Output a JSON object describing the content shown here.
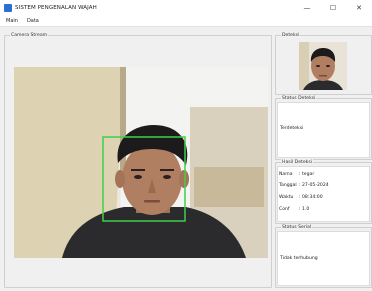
{
  "window": {
    "title": "SISTEM PENGENALAN WAJAH",
    "minimize_glyph": "—",
    "maximize_glyph": "☐",
    "close_glyph": "✕"
  },
  "menu": {
    "items": [
      "Main",
      "Data"
    ]
  },
  "camera": {
    "group_title": "Camera Stream",
    "face_box_color": "#3ecf4a"
  },
  "detect_panel": {
    "title": "Deteksi"
  },
  "status_detect": {
    "title": "Status Deteksi",
    "value": "Terdeteksi"
  },
  "result": {
    "title": "Hasil Deteksi",
    "rows": [
      {
        "label": "Nama",
        "value": ": tegar"
      },
      {
        "label": "Tanggal",
        "value": ": 27-05-2024"
      },
      {
        "label": "Waktu",
        "value": ": 08:34:00"
      },
      {
        "label": "Conf",
        "value": ": 1.0"
      }
    ]
  },
  "serial": {
    "title": "Status Serial",
    "value": "Tidak terhubung"
  }
}
